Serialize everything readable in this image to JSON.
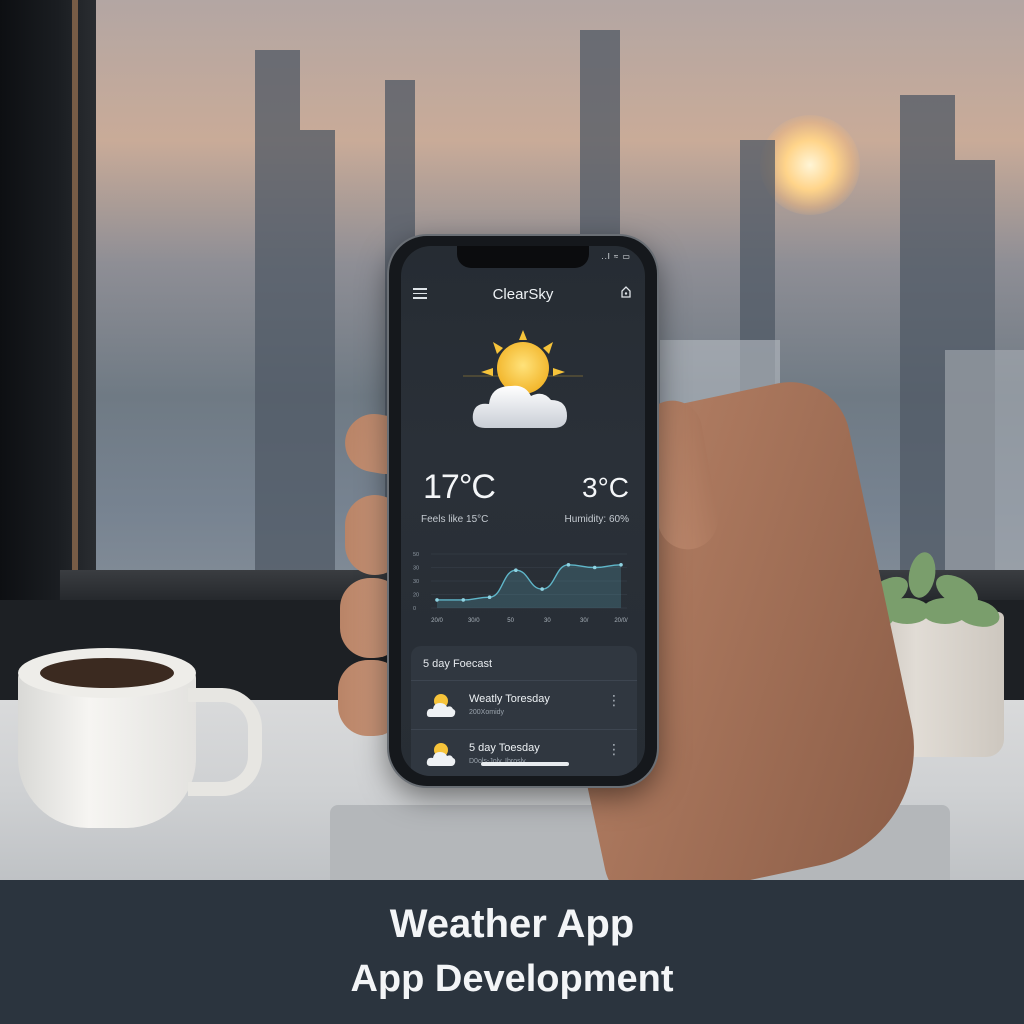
{
  "app": {
    "title": "ClearSky",
    "status_icons": "..l ≈ ▭"
  },
  "current": {
    "temperature": "17°C",
    "secondary_temperature": "3°C",
    "feels_like": "Feels like 15°C",
    "humidity": "Humidity: 60%",
    "condition_icon": "partly-sunny-icon"
  },
  "chart_data": {
    "type": "area",
    "x": [
      "20/0",
      "30/0",
      "50",
      "30",
      "30/",
      "20/0/"
    ],
    "y_ticks": [
      "50",
      "30",
      "30",
      "20",
      "0"
    ],
    "values": [
      3,
      3,
      4,
      14,
      7,
      16,
      15,
      16
    ],
    "grid": true
  },
  "forecast": {
    "title": "5 day Foecast",
    "items": [
      {
        "name": "Weatly Toresday",
        "sub": "200Xomidy",
        "icon": "partly-sunny-icon"
      },
      {
        "name": "5 day Toesday",
        "sub": "D0ols-Joly, Ibrosly",
        "icon": "partly-sunny-icon"
      }
    ]
  },
  "caption": {
    "line1": "Weather App",
    "line2": "App Development"
  },
  "colors": {
    "screen_bg": "#2a3038",
    "caption_bg": "#2b343e",
    "sun": "#f6c33a",
    "chart_line": "#5fb6c9"
  }
}
